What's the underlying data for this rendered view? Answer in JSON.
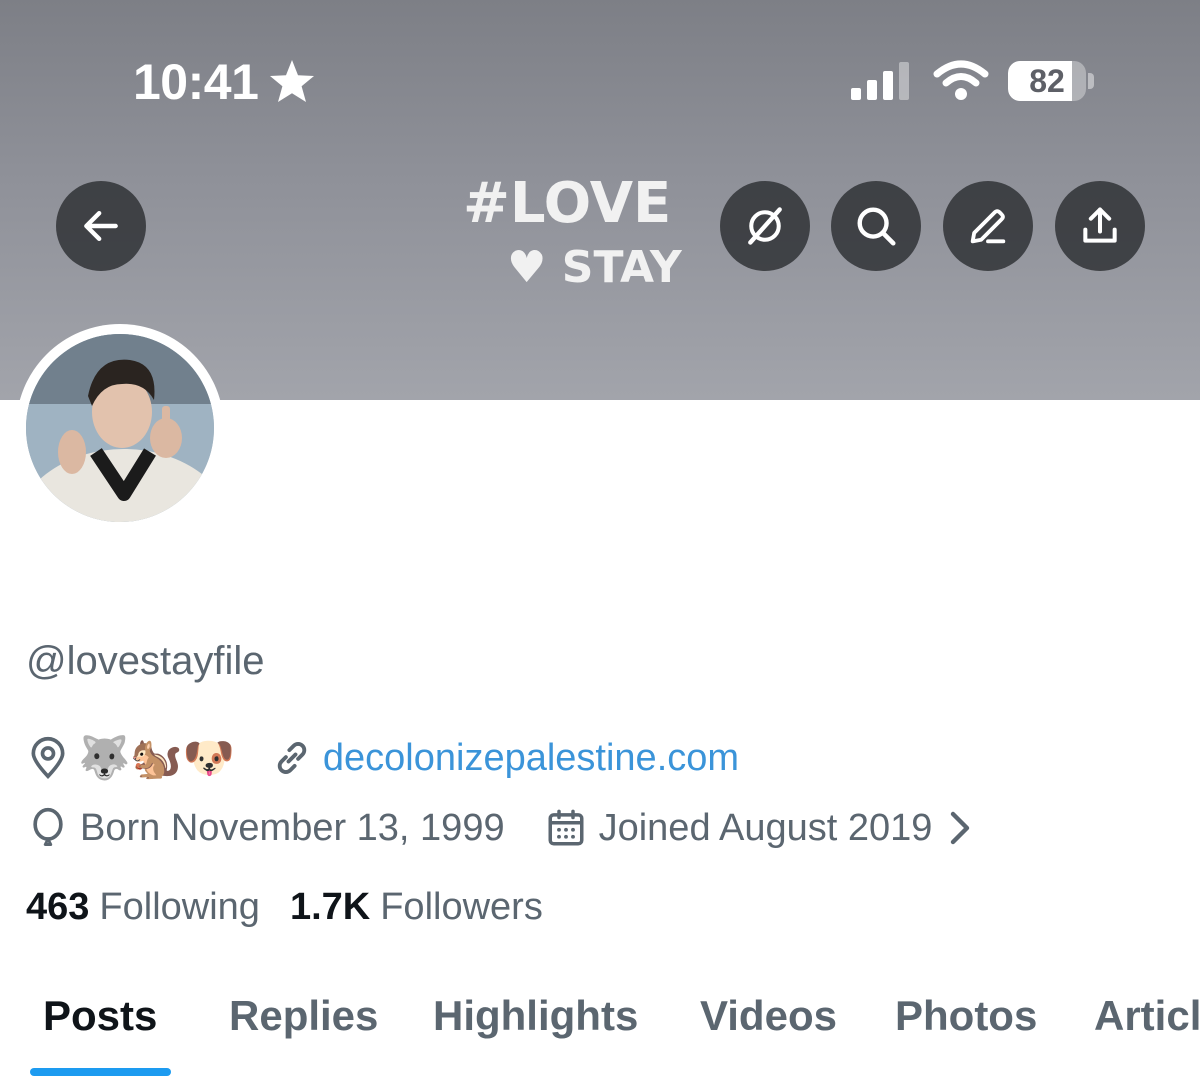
{
  "status_bar": {
    "time": "10:41",
    "battery_level": "82",
    "battery_percent": 82
  },
  "banner": {
    "art_line1": "#LOVE",
    "art_line2": "♥ STAY"
  },
  "header_buttons": {
    "back_icon": "arrow-left-icon",
    "grok_icon": "slash-circle-icon",
    "search_icon": "search-icon",
    "edit_icon": "pencil-icon",
    "share_icon": "share-icon"
  },
  "profile": {
    "handle": "@lovestayfile",
    "location_emojis": "🐺🐿️🐶",
    "website": "decolonizepalestine.com",
    "birthday": "Born November 13, 1999",
    "joined": "Joined August 2019",
    "following_count": "463",
    "following_label": "Following",
    "followers_count": "1.7K",
    "followers_label": "Followers"
  },
  "tabs": [
    {
      "label": "Posts",
      "active": true
    },
    {
      "label": "Replies",
      "active": false
    },
    {
      "label": "Highlights",
      "active": false
    },
    {
      "label": "Videos",
      "active": false
    },
    {
      "label": "Photos",
      "active": false
    },
    {
      "label": "Articles",
      "active": false
    }
  ],
  "colors": {
    "accent": "#1d9bf0",
    "link": "#3b94d9",
    "secondary_text": "#5b6670",
    "primary_text": "#0f1419",
    "banner": "#8f9199"
  }
}
